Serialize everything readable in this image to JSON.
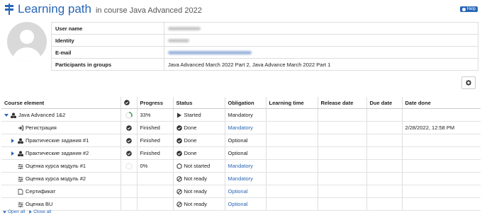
{
  "header": {
    "title": "Learning path",
    "subtitle": "in course Java Advanced 2022",
    "help_label": "Help"
  },
  "user_info": [
    {
      "key": "User name",
      "value": "",
      "blurred": true,
      "blur_width": 46
    },
    {
      "key": "Identity",
      "value": "",
      "blurred": true,
      "blur_width": 30
    },
    {
      "key": "E-mail",
      "value": "",
      "blurred": true,
      "blur_width": 118
    },
    {
      "key": "Participants in groups",
      "value": "Java Advanced March 2022 Part 2, Java Advance March 2022 Part 1"
    }
  ],
  "columns": [
    "Course element",
    "",
    "Progress",
    "Status",
    "Obligation",
    "Learning time",
    "Release date",
    "Due date",
    "Date done"
  ],
  "rows": [
    {
      "indent": 0,
      "toggle": "down",
      "icon": "structure",
      "name": "Java Advanced 1&2",
      "check": "progress-ring",
      "progress": "33%",
      "status_icon": "play",
      "status": "Started",
      "obligation": "Mandatory",
      "obligation_link": false,
      "learning_time": "",
      "release_date": "",
      "due_date": "",
      "date_done": ""
    },
    {
      "indent": 1,
      "toggle": "",
      "icon": "enrol",
      "name": "Регистрация",
      "check": "done",
      "progress": "Finished",
      "status_icon": "check",
      "status": "Done",
      "obligation": "Mandatory",
      "obligation_link": true,
      "learning_time": "",
      "release_date": "",
      "due_date": "",
      "date_done": "2/28/2022, 12:58 PM"
    },
    {
      "indent": 1,
      "toggle": "right",
      "icon": "structure",
      "name": "Практические задания #1",
      "check": "done",
      "progress": "Finished",
      "status_icon": "check",
      "status": "Done",
      "obligation": "Optional",
      "obligation_link": false,
      "learning_time": "",
      "release_date": "",
      "due_date": "",
      "date_done": ""
    },
    {
      "indent": 1,
      "toggle": "right",
      "icon": "structure",
      "name": "Практические задания #2",
      "check": "done",
      "progress": "Finished",
      "status_icon": "check",
      "status": "Done",
      "obligation": "Optional",
      "obligation_link": false,
      "learning_time": "",
      "release_date": "",
      "due_date": "",
      "date_done": ""
    },
    {
      "indent": 1,
      "toggle": "",
      "icon": "assessment",
      "name": "Оценка курса модуль #1",
      "check": "empty-ring",
      "progress": "0%",
      "status_icon": "circle",
      "status": "Not started",
      "obligation": "Mandatory",
      "obligation_link": true,
      "learning_time": "",
      "release_date": "",
      "due_date": "",
      "date_done": ""
    },
    {
      "indent": 1,
      "toggle": "",
      "icon": "assessment",
      "name": "Оценка курса модуль #2",
      "check": "",
      "progress": "",
      "status_icon": "ban",
      "status": "Not ready",
      "obligation": "Mandatory",
      "obligation_link": true,
      "learning_time": "",
      "release_date": "",
      "due_date": "",
      "date_done": ""
    },
    {
      "indent": 1,
      "toggle": "",
      "icon": "page",
      "name": "Сертификат",
      "check": "",
      "progress": "",
      "status_icon": "ban",
      "status": "Not ready",
      "obligation": "Optional",
      "obligation_link": true,
      "learning_time": "",
      "release_date": "",
      "due_date": "",
      "date_done": ""
    },
    {
      "indent": 1,
      "toggle": "",
      "icon": "assessment",
      "name": "Оценка BU",
      "check": "",
      "progress": "",
      "status_icon": "ban",
      "status": "Not ready",
      "obligation": "Optional",
      "obligation_link": true,
      "learning_time": "",
      "release_date": "",
      "due_date": "",
      "date_done": ""
    }
  ],
  "footer": {
    "open_all": "Open all",
    "close_all": "Close all"
  },
  "colors": {
    "accent": "#2866b8",
    "ring": "#3fa04a"
  }
}
